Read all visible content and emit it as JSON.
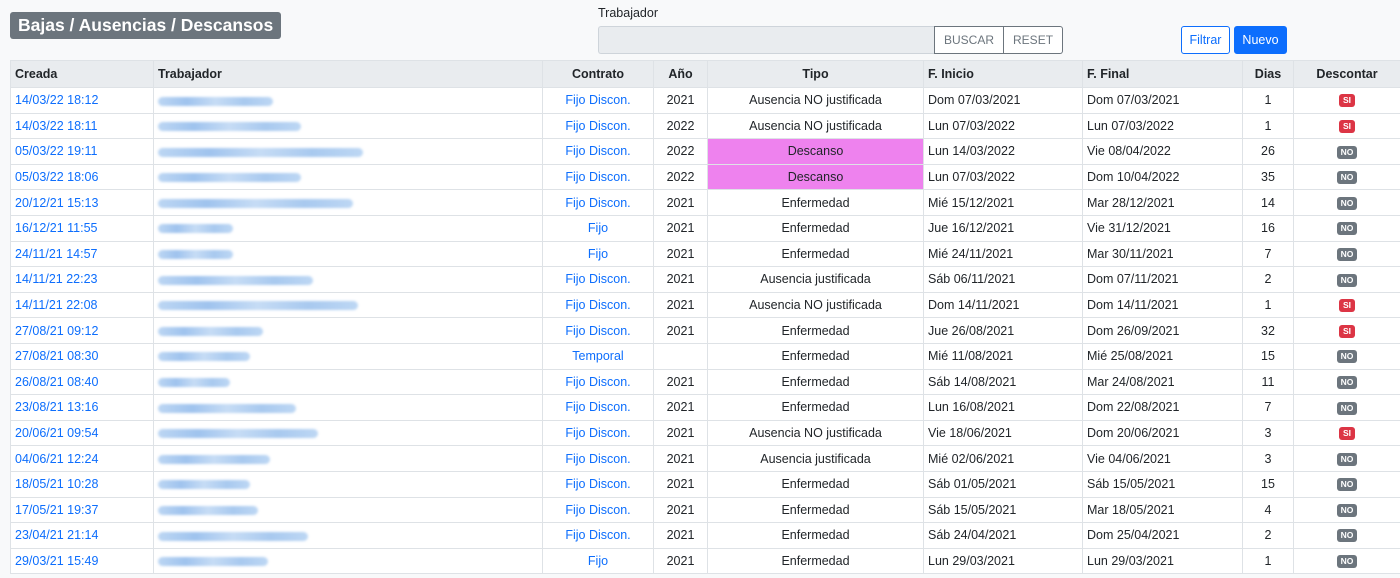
{
  "header": {
    "title": "Bajas / Ausencias / Descansos",
    "search_label": "Trabajador",
    "search_value": "",
    "search_placeholder": "",
    "buscar_label": "BUSCAR",
    "reset_label": "RESET",
    "filtrar_label": "Filtrar",
    "nuevo_label": "Nuevo"
  },
  "colors": {
    "link": "#0d6efd",
    "descanso_highlight": "#ee82ee",
    "badge_si": "#dc3545",
    "badge_no": "#6c757d",
    "title_bg": "#6c757d"
  },
  "table": {
    "columns": [
      "Creada",
      "Trabajador",
      "Contrato",
      "Año",
      "Tipo",
      "F. Inicio",
      "F. Final",
      "Dias",
      "Descontar"
    ],
    "rows": [
      {
        "creada": "14/03/22 18:12",
        "trabajador_blur": 115,
        "contrato": "Fijo Discon.",
        "anio": "2021",
        "tipo": "Ausencia NO justificada",
        "inicio": "Dom 07/03/2021",
        "final": "Dom 07/03/2021",
        "dias": "1",
        "descontar": "SI"
      },
      {
        "creada": "14/03/22 18:11",
        "trabajador_blur": 143,
        "contrato": "Fijo Discon.",
        "anio": "2022",
        "tipo": "Ausencia NO justificada",
        "inicio": "Lun 07/03/2022",
        "final": "Lun 07/03/2022",
        "dias": "1",
        "descontar": "SI"
      },
      {
        "creada": "05/03/22 19:11",
        "trabajador_blur": 205,
        "contrato": "Fijo Discon.",
        "anio": "2022",
        "tipo": "Descanso",
        "inicio": "Lun 14/03/2022",
        "final": "Vie 08/04/2022",
        "dias": "26",
        "descontar": "NO"
      },
      {
        "creada": "05/03/22 18:06",
        "trabajador_blur": 143,
        "contrato": "Fijo Discon.",
        "anio": "2022",
        "tipo": "Descanso",
        "inicio": "Lun 07/03/2022",
        "final": "Dom 10/04/2022",
        "dias": "35",
        "descontar": "NO"
      },
      {
        "creada": "20/12/21 15:13",
        "trabajador_blur": 195,
        "contrato": "Fijo Discon.",
        "anio": "2021",
        "tipo": "Enfermedad",
        "inicio": "Mié 15/12/2021",
        "final": "Mar 28/12/2021",
        "dias": "14",
        "descontar": "NO"
      },
      {
        "creada": "16/12/21 11:55",
        "trabajador_blur": 75,
        "contrato": "Fijo",
        "anio": "2021",
        "tipo": "Enfermedad",
        "inicio": "Jue 16/12/2021",
        "final": "Vie 31/12/2021",
        "dias": "16",
        "descontar": "NO"
      },
      {
        "creada": "24/11/21 14:57",
        "trabajador_blur": 75,
        "contrato": "Fijo",
        "anio": "2021",
        "tipo": "Enfermedad",
        "inicio": "Mié 24/11/2021",
        "final": "Mar 30/11/2021",
        "dias": "7",
        "descontar": "NO"
      },
      {
        "creada": "14/11/21 22:23",
        "trabajador_blur": 155,
        "contrato": "Fijo Discon.",
        "anio": "2021",
        "tipo": "Ausencia justificada",
        "inicio": "Sáb 06/11/2021",
        "final": "Dom 07/11/2021",
        "dias": "2",
        "descontar": "NO"
      },
      {
        "creada": "14/11/21 22:08",
        "trabajador_blur": 200,
        "contrato": "Fijo Discon.",
        "anio": "2021",
        "tipo": "Ausencia NO justificada",
        "inicio": "Dom 14/11/2021",
        "final": "Dom 14/11/2021",
        "dias": "1",
        "descontar": "SI"
      },
      {
        "creada": "27/08/21 09:12",
        "trabajador_blur": 105,
        "contrato": "Fijo Discon.",
        "anio": "2021",
        "tipo": "Enfermedad",
        "inicio": "Jue 26/08/2021",
        "final": "Dom 26/09/2021",
        "dias": "32",
        "descontar": "SI"
      },
      {
        "creada": "27/08/21 08:30",
        "trabajador_blur": 92,
        "contrato": "Temporal",
        "anio": "",
        "tipo": "Enfermedad",
        "inicio": "Mié 11/08/2021",
        "final": "Mié 25/08/2021",
        "dias": "15",
        "descontar": "NO"
      },
      {
        "creada": "26/08/21 08:40",
        "trabajador_blur": 72,
        "contrato": "Fijo Discon.",
        "anio": "2021",
        "tipo": "Enfermedad",
        "inicio": "Sáb 14/08/2021",
        "final": "Mar 24/08/2021",
        "dias": "11",
        "descontar": "NO"
      },
      {
        "creada": "23/08/21 13:16",
        "trabajador_blur": 138,
        "contrato": "Fijo Discon.",
        "anio": "2021",
        "tipo": "Enfermedad",
        "inicio": "Lun 16/08/2021",
        "final": "Dom 22/08/2021",
        "dias": "7",
        "descontar": "NO"
      },
      {
        "creada": "20/06/21 09:54",
        "trabajador_blur": 160,
        "contrato": "Fijo Discon.",
        "anio": "2021",
        "tipo": "Ausencia NO justificada",
        "inicio": "Vie 18/06/2021",
        "final": "Dom 20/06/2021",
        "dias": "3",
        "descontar": "SI"
      },
      {
        "creada": "04/06/21 12:24",
        "trabajador_blur": 112,
        "contrato": "Fijo Discon.",
        "anio": "2021",
        "tipo": "Ausencia justificada",
        "inicio": "Mié 02/06/2021",
        "final": "Vie 04/06/2021",
        "dias": "3",
        "descontar": "NO"
      },
      {
        "creada": "18/05/21 10:28",
        "trabajador_blur": 92,
        "contrato": "Fijo Discon.",
        "anio": "2021",
        "tipo": "Enfermedad",
        "inicio": "Sáb 01/05/2021",
        "final": "Sáb 15/05/2021",
        "dias": "15",
        "descontar": "NO"
      },
      {
        "creada": "17/05/21 19:37",
        "trabajador_blur": 100,
        "contrato": "Fijo Discon.",
        "anio": "2021",
        "tipo": "Enfermedad",
        "inicio": "Sáb 15/05/2021",
        "final": "Mar 18/05/2021",
        "dias": "4",
        "descontar": "NO"
      },
      {
        "creada": "23/04/21 21:14",
        "trabajador_blur": 150,
        "contrato": "Fijo Discon.",
        "anio": "2021",
        "tipo": "Enfermedad",
        "inicio": "Sáb 24/04/2021",
        "final": "Dom 25/04/2021",
        "dias": "2",
        "descontar": "NO"
      },
      {
        "creada": "29/03/21 15:49",
        "trabajador_blur": 110,
        "contrato": "Fijo",
        "anio": "2021",
        "tipo": "Enfermedad",
        "inicio": "Lun 29/03/2021",
        "final": "Lun 29/03/2021",
        "dias": "1",
        "descontar": "NO"
      }
    ]
  }
}
